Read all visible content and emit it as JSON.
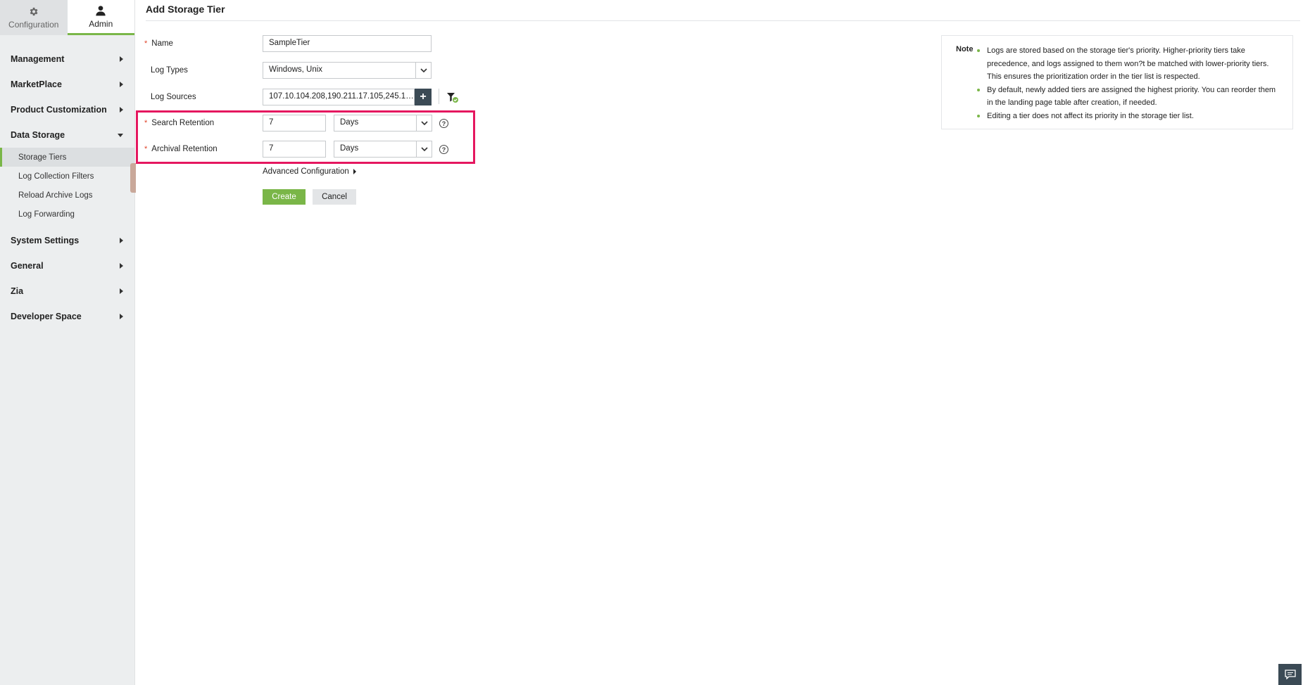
{
  "top_tabs": [
    {
      "label": "Configuration",
      "icon": "gear-icon"
    },
    {
      "label": "Admin",
      "icon": "user-icon"
    }
  ],
  "sidebar": {
    "items": [
      {
        "label": "Management"
      },
      {
        "label": "MarketPlace"
      },
      {
        "label": "Product Customization"
      },
      {
        "label": "Data Storage",
        "expanded": true
      },
      {
        "label": "System Settings"
      },
      {
        "label": "General"
      },
      {
        "label": "Zia"
      },
      {
        "label": "Developer Space"
      }
    ],
    "data_storage_sub": [
      {
        "label": "Storage Tiers",
        "active": true
      },
      {
        "label": "Log Collection Filters"
      },
      {
        "label": "Reload Archive Logs"
      },
      {
        "label": "Log Forwarding"
      }
    ]
  },
  "page": {
    "title": "Add Storage Tier"
  },
  "form": {
    "name_label": "Name",
    "name_value": "SampleTier",
    "log_types_label": "Log Types",
    "log_types_value": "Windows, Unix",
    "log_sources_label": "Log Sources",
    "log_sources_value": "107.10.104.208,190.211.17.105,245.1…",
    "search_retention_label": "Search Retention",
    "search_retention_value": "7",
    "search_retention_unit": "Days",
    "archival_retention_label": "Archival Retention",
    "archival_retention_value": "7",
    "archival_retention_unit": "Days",
    "help_glyph": "?",
    "plus_glyph": "+",
    "advanced_label": "Advanced Configuration",
    "create_label": "Create",
    "cancel_label": "Cancel"
  },
  "note": {
    "title": "Note",
    "items": [
      "Logs are stored based on the storage tier's priority. Higher-priority tiers take precedence, and logs assigned to them won?t be matched with lower-priority tiers. This ensures the prioritization order in the tier list is respected.",
      "By default, newly added tiers are assigned the highest priority. You can reorder them in the landing page table after creation, if needed.",
      "Editing a tier does not affect its priority in the storage tier list."
    ]
  },
  "colors": {
    "accent": "#7ab648",
    "highlight": "#e5175f",
    "required": "#e0442a",
    "dark": "#3b4a55"
  }
}
